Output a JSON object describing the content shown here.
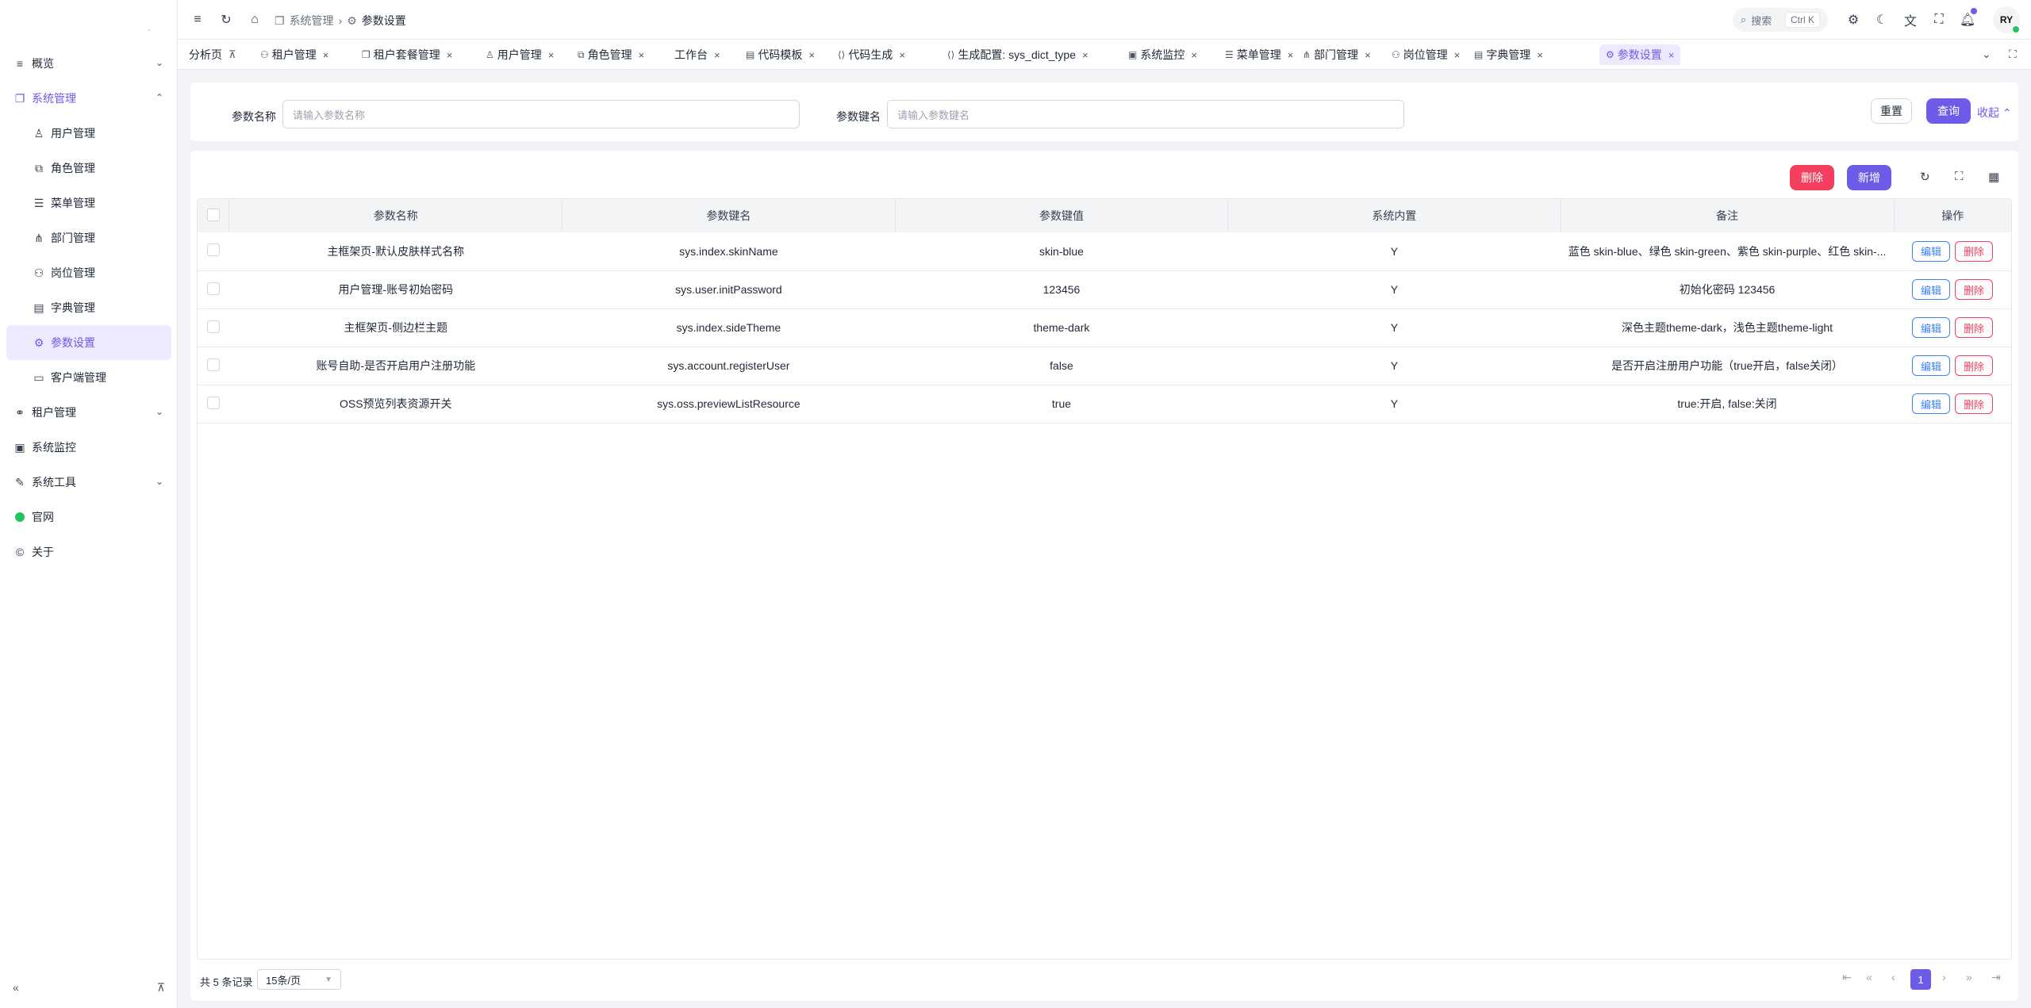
{
  "sidebar": {
    "collapse_marker": ".",
    "items": [
      {
        "label": "概览",
        "icon": "list-icon",
        "chevron": "⌄"
      },
      {
        "label": "系统管理",
        "icon": "system-icon",
        "chevron": "⌃",
        "active": true
      },
      {
        "label": "用户管理",
        "icon": "user-icon",
        "sub": true
      },
      {
        "label": "角色管理",
        "icon": "role-icon",
        "sub": true
      },
      {
        "label": "菜单管理",
        "icon": "menu-icon",
        "sub": true
      },
      {
        "label": "部门管理",
        "icon": "dept-icon",
        "sub": true
      },
      {
        "label": "岗位管理",
        "icon": "post-icon",
        "sub": true
      },
      {
        "label": "字典管理",
        "icon": "dict-icon",
        "sub": true
      },
      {
        "label": "参数设置",
        "icon": "gear-icon",
        "sub": true,
        "selected": true
      },
      {
        "label": "客户端管理",
        "icon": "client-icon",
        "sub": true
      },
      {
        "label": "租户管理",
        "icon": "tenant-icon",
        "chevron": "⌄"
      },
      {
        "label": "系统监控",
        "icon": "monitor-icon"
      },
      {
        "label": "系统工具",
        "icon": "tool-icon",
        "chevron": "⌄"
      },
      {
        "label": "官网",
        "icon": "website-icon"
      },
      {
        "label": "关于",
        "icon": "copyright-icon"
      }
    ]
  },
  "header": {
    "breadcrumb": [
      "系统管理",
      "参数设置"
    ],
    "search_placeholder": "搜索",
    "search_shortcut": "Ctrl K",
    "avatar": "RY"
  },
  "tabs": [
    {
      "label": "分析页",
      "pinned": true
    },
    {
      "label": "租户管理"
    },
    {
      "label": "租户套餐管理"
    },
    {
      "label": "用户管理"
    },
    {
      "label": "角色管理"
    },
    {
      "label": "工作台"
    },
    {
      "label": "代码模板"
    },
    {
      "label": "代码生成"
    },
    {
      "label": "生成配置: sys_dict_type"
    },
    {
      "label": "系统监控"
    },
    {
      "label": "菜单管理"
    },
    {
      "label": "部门管理"
    },
    {
      "label": "岗位管理"
    },
    {
      "label": "字典管理"
    },
    {
      "label": "参数设置",
      "active": true
    }
  ],
  "filter": {
    "name_label": "参数名称",
    "name_placeholder": "请输入参数名称",
    "key_label": "参数键名",
    "key_placeholder": "请输入参数键名",
    "reset": "重置",
    "query": "查询",
    "collapse": "收起"
  },
  "toolbar": {
    "delete": "删除",
    "add": "新增"
  },
  "table": {
    "columns": [
      "参数名称",
      "参数键名",
      "参数键值",
      "系统内置",
      "备注",
      "操作"
    ],
    "rows": [
      [
        "主框架页-默认皮肤样式名称",
        "sys.index.skinName",
        "skin-blue",
        "Y",
        "蓝色 skin-blue、绿色 skin-green、紫色 skin-purple、红色 skin-..."
      ],
      [
        "用户管理-账号初始密码",
        "sys.user.initPassword",
        "123456",
        "Y",
        "初始化密码 123456"
      ],
      [
        "主框架页-侧边栏主题",
        "sys.index.sideTheme",
        "theme-dark",
        "Y",
        "深色主题theme-dark，浅色主题theme-light"
      ],
      [
        "账号自助-是否开启用户注册功能",
        "sys.account.registerUser",
        "false",
        "Y",
        "是否开启注册用户功能（true开启，false关闭）"
      ],
      [
        "OSS预览列表资源开关",
        "sys.oss.previewListResource",
        "true",
        "Y",
        "true:开启, false:关闭"
      ]
    ],
    "edit": "编辑",
    "del": "删除"
  },
  "pager": {
    "total": "共 5 条记录",
    "size": "15条/页",
    "page": "1"
  },
  "colors": {
    "accent": "#6c5ce7",
    "danger": "#f43f5e",
    "link": "#3b82f6"
  }
}
